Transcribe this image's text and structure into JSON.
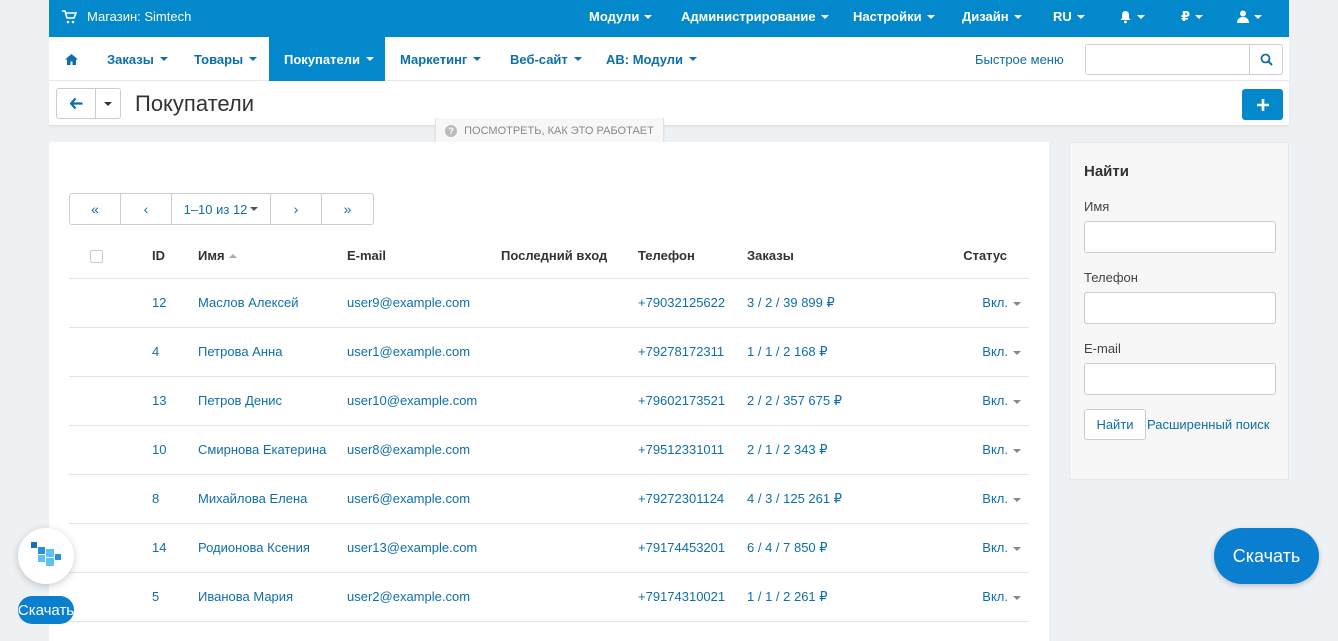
{
  "topbar": {
    "store_label": "Магазин: Simtech",
    "menus": [
      "Модули",
      "Администрирование",
      "Настройки",
      "Дизайн",
      "RU",
      "₽"
    ]
  },
  "mainnav": {
    "items": [
      "Заказы",
      "Товары",
      "Покупатели",
      "Маркетинг",
      "Веб-сайт",
      "AB: Модули"
    ],
    "active": "Покупатели",
    "quick_menu": "Быстрое меню",
    "search_placeholder": ""
  },
  "titlebar": {
    "title": "Покупатели",
    "how_it_works": "ПОСМОТРЕТЬ, КАК ЭТО РАБОТАЕТ"
  },
  "pagination": {
    "first": "«",
    "prev": "‹",
    "info": "1–10 из 12",
    "next": "›",
    "last": "»"
  },
  "table": {
    "headers": {
      "id": "ID",
      "name": "Имя",
      "email": "E-mail",
      "last_login": "Последний вход",
      "phone": "Телефон",
      "orders": "Заказы",
      "status": "Статус"
    },
    "rows": [
      {
        "id": "12",
        "name": "Маслов Алексей",
        "email": "user9@example.com",
        "last_login": "",
        "phone": "+79032125622",
        "orders": "3 / 2 / 39 899 ₽",
        "status": "Вкл."
      },
      {
        "id": "4",
        "name": "Петрова Анна",
        "email": "user1@example.com",
        "last_login": "",
        "phone": "+79278172311",
        "orders": "1 / 1 / 2 168 ₽",
        "status": "Вкл."
      },
      {
        "id": "13",
        "name": "Петров Денис",
        "email": "user10@example.com",
        "last_login": "",
        "phone": "+79602173521",
        "orders": "2 / 2 / 357 675 ₽",
        "status": "Вкл."
      },
      {
        "id": "10",
        "name": "Смирнова Екатерина",
        "email": "user8@example.com",
        "last_login": "",
        "phone": "+79512331011",
        "orders": "2 / 1 / 2 343 ₽",
        "status": "Вкл."
      },
      {
        "id": "8",
        "name": "Михайлова Елена",
        "email": "user6@example.com",
        "last_login": "",
        "phone": "+79272301124",
        "orders": "4 / 3 / 125 261 ₽",
        "status": "Вкл."
      },
      {
        "id": "14",
        "name": "Родионова Ксения",
        "email": "user13@example.com",
        "last_login": "",
        "phone": "+79174453201",
        "orders": "6 / 4 / 7 850 ₽",
        "status": "Вкл."
      },
      {
        "id": "5",
        "name": "Иванова Мария",
        "email": "user2@example.com",
        "last_login": "",
        "phone": "+79174310021",
        "orders": "1 / 1 / 2 261 ₽",
        "status": "Вкл."
      }
    ]
  },
  "sidebar": {
    "title": "Найти",
    "name_label": "Имя",
    "phone_label": "Телефон",
    "email_label": "E-mail",
    "find_button": "Найти",
    "advanced_link": "Расширенный поиск"
  },
  "floating": {
    "download_small": "Скачать",
    "download_button": "Скачать"
  },
  "colors": {
    "accent": "#0388cc",
    "link": "#0e6fa8",
    "background": "#eef1f4"
  }
}
